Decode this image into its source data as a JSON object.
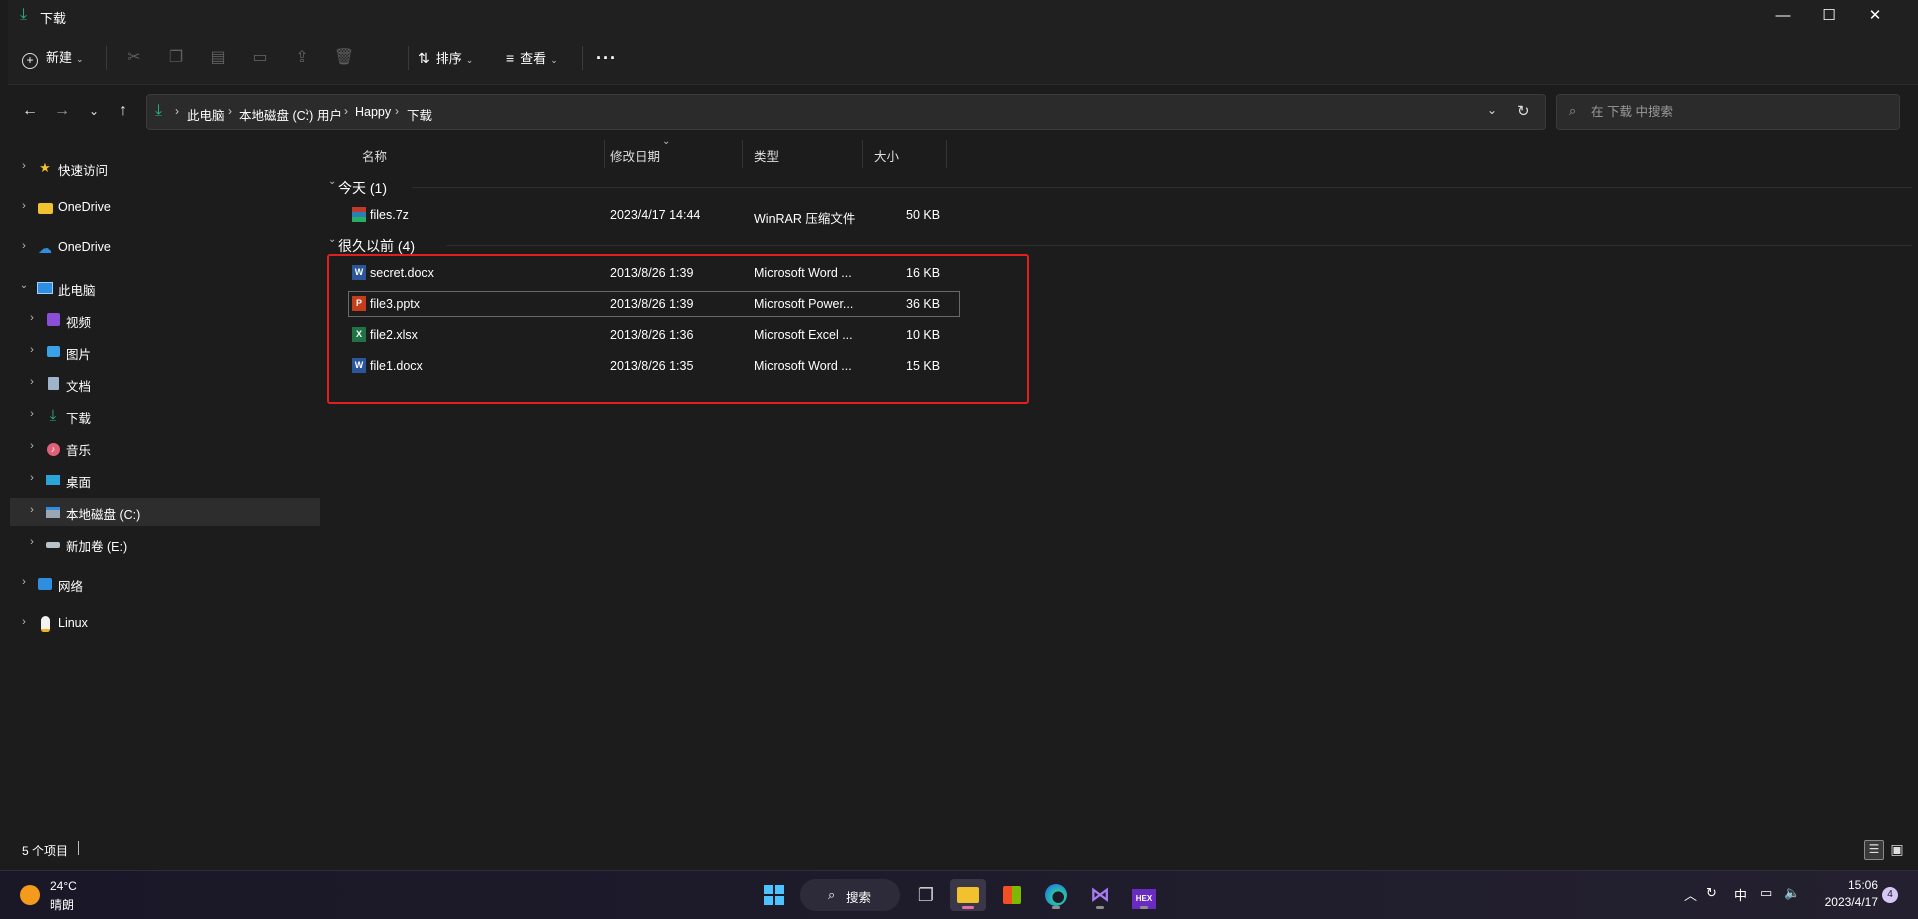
{
  "window": {
    "title": "下载",
    "controls": {
      "minimize": "—",
      "maximize": "☐",
      "close": "✕"
    }
  },
  "toolbar": {
    "new_label": "新建",
    "sort_label": "排序",
    "view_label": "查看",
    "more_label": "···"
  },
  "address": {
    "crumbs": [
      "此电脑",
      "本地磁盘 (C:)",
      "用户",
      "Happy",
      "下载"
    ]
  },
  "search": {
    "placeholder": "在 下载 中搜索"
  },
  "sidebar": {
    "items": [
      {
        "label": "快速访问",
        "icon": "star-icon"
      },
      {
        "label": "OneDrive",
        "icon": "folder-icon"
      },
      {
        "label": "OneDrive",
        "icon": "cloud-icon"
      },
      {
        "label": "此电脑",
        "icon": "computer-icon"
      },
      {
        "label": "视频",
        "icon": "video-icon"
      },
      {
        "label": "图片",
        "icon": "picture-icon"
      },
      {
        "label": "文档",
        "icon": "document-icon"
      },
      {
        "label": "下载",
        "icon": "download-icon"
      },
      {
        "label": "音乐",
        "icon": "music-icon"
      },
      {
        "label": "桌面",
        "icon": "desktop-icon"
      },
      {
        "label": "本地磁盘 (C:)",
        "icon": "drive-icon"
      },
      {
        "label": "新加卷 (E:)",
        "icon": "drive-icon"
      },
      {
        "label": "网络",
        "icon": "network-icon"
      },
      {
        "label": "Linux",
        "icon": "linux-icon"
      }
    ]
  },
  "columns": {
    "name": "名称",
    "date": "修改日期",
    "type": "类型",
    "size": "大小"
  },
  "groups": [
    {
      "header": "今天 (1)",
      "files": [
        {
          "name": "files.7z",
          "date": "2023/4/17 14:44",
          "type": "WinRAR 压缩文件",
          "size": "50 KB",
          "icon": "archive-icon"
        }
      ]
    },
    {
      "header": "很久以前 (4)",
      "files": [
        {
          "name": "secret.docx",
          "date": "2013/8/26 1:39",
          "type": "Microsoft Word ...",
          "size": "16 KB",
          "icon": "word-icon"
        },
        {
          "name": "file3.pptx",
          "date": "2013/8/26 1:39",
          "type": "Microsoft Power...",
          "size": "36 KB",
          "icon": "powerpoint-icon"
        },
        {
          "name": "file2.xlsx",
          "date": "2013/8/26 1:36",
          "type": "Microsoft Excel ...",
          "size": "10 KB",
          "icon": "excel-icon"
        },
        {
          "name": "file1.docx",
          "date": "2013/8/26 1:35",
          "type": "Microsoft Word ...",
          "size": "15 KB",
          "icon": "word-icon"
        }
      ]
    }
  ],
  "status": {
    "count": "5 个项目"
  },
  "taskbar": {
    "weather_temp": "24°C",
    "weather_desc": "晴朗",
    "search_label": "搜索",
    "ime": "中",
    "time": "15:06",
    "date": "2023/4/17",
    "notifications": "4",
    "hex_app_label": "HEX"
  },
  "colors": {
    "accent": "#27b38a",
    "highlight_box": "#e0201e"
  }
}
